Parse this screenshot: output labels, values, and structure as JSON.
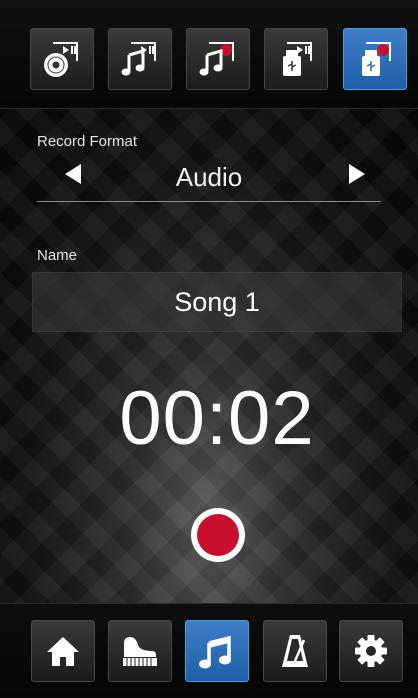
{
  "top_tabs": [
    {
      "icon": "cd-play-icon",
      "active": false
    },
    {
      "icon": "music-play-icon",
      "active": false
    },
    {
      "icon": "music-record-icon",
      "active": false
    },
    {
      "icon": "usb-play-icon",
      "active": false
    },
    {
      "icon": "usb-record-icon",
      "active": true
    }
  ],
  "record_format": {
    "label": "Record Format",
    "value": "Audio"
  },
  "name": {
    "label": "Name",
    "value": "Song 1"
  },
  "timer": "00:02",
  "bottom_nav": [
    {
      "icon": "home-icon",
      "active": false
    },
    {
      "icon": "piano-icon",
      "active": false
    },
    {
      "icon": "music-note-icon",
      "active": true
    },
    {
      "icon": "metronome-icon",
      "active": false
    },
    {
      "icon": "settings-gear-icon",
      "active": false
    }
  ],
  "colors": {
    "accent": "#2e6fb8",
    "record": "#c8102e"
  }
}
